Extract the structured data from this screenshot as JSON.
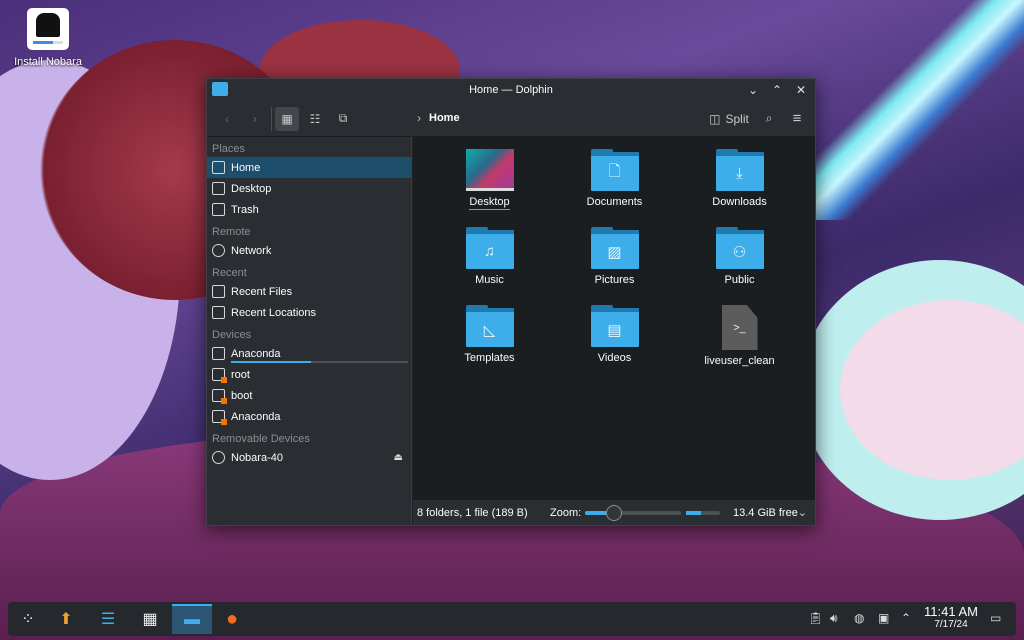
{
  "desktop": {
    "icons": [
      {
        "label": "Install Nobara",
        "icon": "nobara-installer-icon"
      }
    ]
  },
  "window": {
    "title": "Home — Dolphin",
    "controls": [
      "minimize",
      "maximize",
      "close"
    ],
    "toolbar": {
      "back": "back-icon",
      "forward": "forward-icon",
      "view_modes": [
        "icons",
        "compact",
        "details"
      ],
      "active_view": "icons",
      "breadcrumb": [
        "Home"
      ],
      "split_label": "Split",
      "search": "search-icon",
      "menu": "hamburger-menu-icon"
    },
    "sidebar": {
      "sections": [
        {
          "title": "Places",
          "items": [
            {
              "label": "Home",
              "icon": "home-icon",
              "active": true
            },
            {
              "label": "Desktop",
              "icon": "desktop-icon"
            },
            {
              "label": "Trash",
              "icon": "trash-icon"
            }
          ]
        },
        {
          "title": "Remote",
          "items": [
            {
              "label": "Network",
              "icon": "network-icon"
            }
          ]
        },
        {
          "title": "Recent",
          "items": [
            {
              "label": "Recent Files",
              "icon": "recent-files-icon"
            },
            {
              "label": "Recent Locations",
              "icon": "recent-locations-icon"
            }
          ]
        },
        {
          "title": "Devices",
          "items": [
            {
              "label": "Anaconda",
              "icon": "drive-icon",
              "capacity_used": 0.45
            },
            {
              "label": "root",
              "icon": "drive-locked-icon"
            },
            {
              "label": "boot",
              "icon": "drive-locked-icon"
            },
            {
              "label": "Anaconda",
              "icon": "drive-locked-icon"
            }
          ]
        },
        {
          "title": "Removable Devices",
          "items": [
            {
              "label": "Nobara-40",
              "icon": "optical-disc-icon",
              "eject": true
            }
          ]
        }
      ]
    },
    "files": [
      {
        "name": "Desktop",
        "type": "folder-thumbnail",
        "glyph": ""
      },
      {
        "name": "Documents",
        "type": "folder",
        "glyph": "🗋"
      },
      {
        "name": "Downloads",
        "type": "folder",
        "glyph": "⤓"
      },
      {
        "name": "Music",
        "type": "folder",
        "glyph": "♫"
      },
      {
        "name": "Pictures",
        "type": "folder",
        "glyph": "▨"
      },
      {
        "name": "Public",
        "type": "folder",
        "glyph": "⚇"
      },
      {
        "name": "Templates",
        "type": "folder",
        "glyph": "◺"
      },
      {
        "name": "Videos",
        "type": "folder",
        "glyph": "▤"
      },
      {
        "name": "liveuser_clean",
        "type": "script",
        "glyph": ">_"
      }
    ],
    "statusbar": {
      "summary": "8 folders, 1 file (189 B)",
      "zoom_label": "Zoom:",
      "zoom_level": 0.3,
      "space_used": 0.45,
      "free_space": "13.4 GiB free"
    }
  },
  "taskbar": {
    "items": [
      {
        "name": "application-launcher",
        "glyph": "⁘"
      },
      {
        "name": "updater",
        "glyph": "⬆"
      },
      {
        "name": "system-settings",
        "glyph": "☰"
      },
      {
        "name": "discover",
        "glyph": "▦"
      },
      {
        "name": "dolphin",
        "glyph": "▭",
        "active": true
      },
      {
        "name": "firefox",
        "glyph": "◉"
      }
    ],
    "tray": [
      "clipboard-icon",
      "volume-icon",
      "network-icon",
      "display-icon",
      "expand-tray-icon"
    ],
    "clock": {
      "time": "11:41 AM",
      "date": "7/17/24"
    },
    "show_desktop": "show-desktop-icon"
  }
}
